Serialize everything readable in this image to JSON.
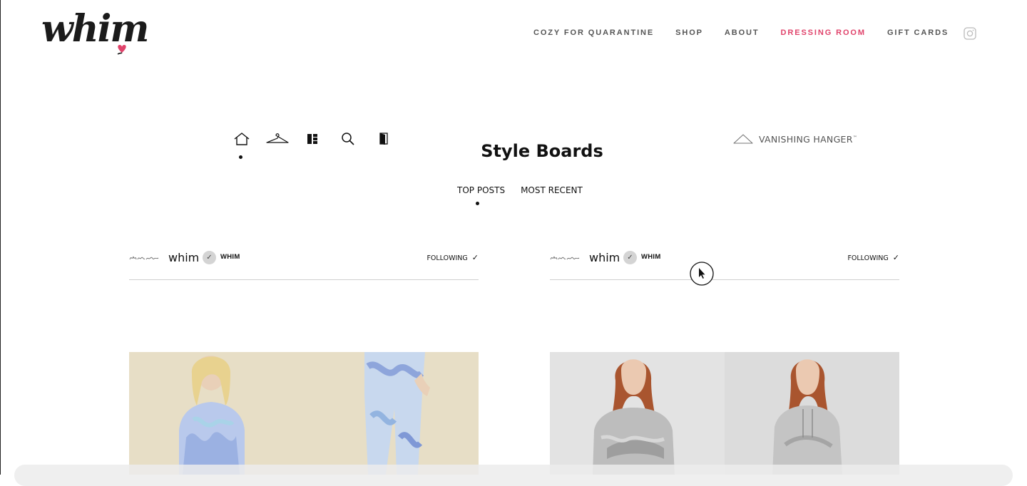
{
  "header": {
    "logo_text": "whim",
    "nav": [
      {
        "label": "COZY FOR QUARANTINE",
        "active": false
      },
      {
        "label": "SHOP",
        "active": false
      },
      {
        "label": "ABOUT",
        "active": false
      },
      {
        "label": "DRESSING ROOM",
        "active": true
      },
      {
        "label": "GIFT CARDS",
        "active": false
      }
    ],
    "accent_color": "#e0436b"
  },
  "toolbar": {
    "icons": [
      "home-icon",
      "hanger-icon",
      "boards-icon",
      "search-icon",
      "closet-door-icon"
    ],
    "selected": "home-icon"
  },
  "page": {
    "title": "Style Boards",
    "vanishing_hanger": "VANISHING HANGER",
    "trademark": "™"
  },
  "tabs": {
    "items": [
      "TOP POSTS",
      "MOST RECENT"
    ],
    "selected": "TOP POSTS"
  },
  "posts": [
    {
      "user": "whim",
      "brand": "WHIM",
      "follow_label": "FOLLOWING",
      "check_glyph": "✓",
      "image": "tie-dye-loungewear-photo"
    },
    {
      "user": "whim",
      "brand": "WHIM",
      "follow_label": "FOLLOWING",
      "check_glyph": "✓",
      "image": "snakeskin-hoodie-photo"
    }
  ]
}
